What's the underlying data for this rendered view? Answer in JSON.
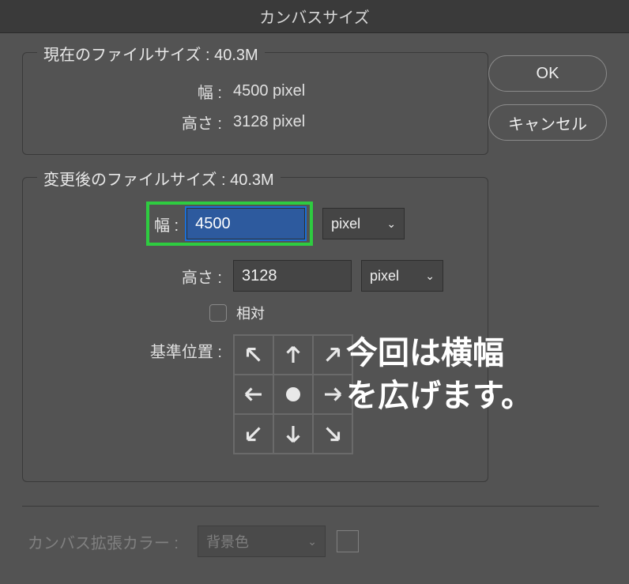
{
  "dialog": {
    "title": "カンバスサイズ"
  },
  "buttons": {
    "ok": "OK",
    "cancel": "キャンセル"
  },
  "current": {
    "legend_prefix": "現在のファイルサイズ :",
    "filesize": "40.3M",
    "width_label": "幅 :",
    "width_value": "4500 pixel",
    "height_label": "高さ :",
    "height_value": "3128 pixel"
  },
  "new": {
    "legend_prefix": "変更後のファイルサイズ :",
    "filesize": "40.3M",
    "width_label": "幅 :",
    "width_value": "4500",
    "width_unit": "pixel",
    "height_label": "高さ :",
    "height_value": "3128",
    "height_unit": "pixel",
    "relative_label": "相対",
    "anchor_label": "基準位置 :"
  },
  "extension": {
    "label": "カンバス拡張カラー :",
    "value": "背景色"
  },
  "annotation": {
    "line1": "今回は横幅",
    "line2": "を広げます。"
  }
}
